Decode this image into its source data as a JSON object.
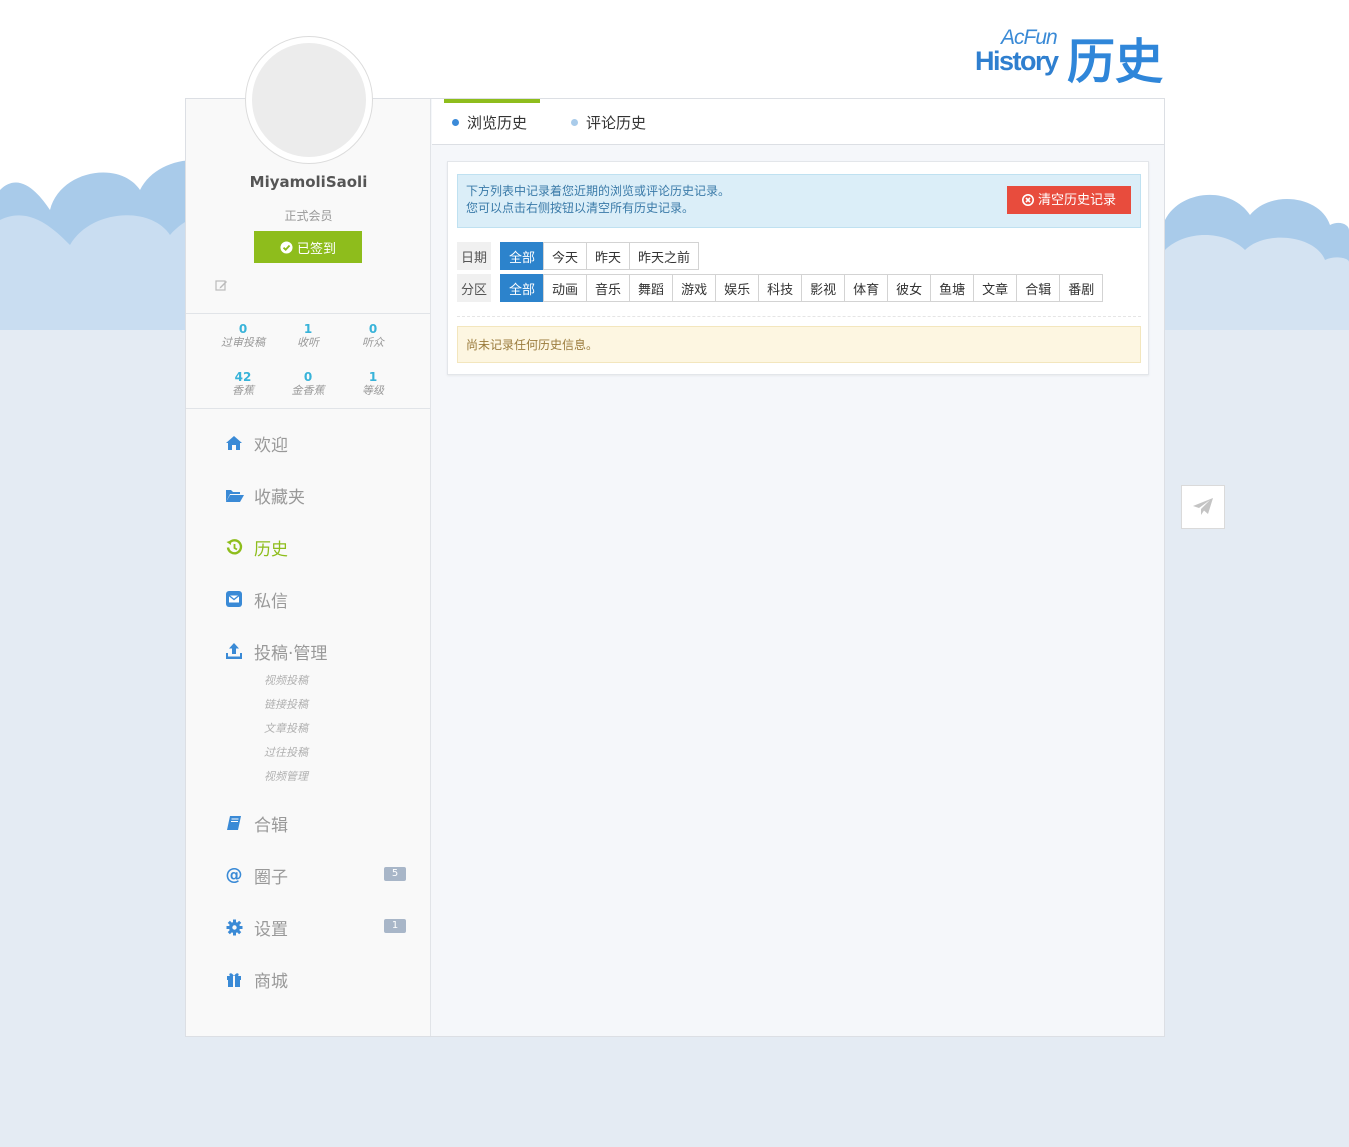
{
  "header": {
    "logo_acfun": "AcFun",
    "logo_history": "History",
    "logo_cn": "历史"
  },
  "profile": {
    "username": "MiyamoliSaoli",
    "member_level": "正式会员",
    "signed_label": "已签到"
  },
  "stats": [
    {
      "num": "0",
      "label": "过审投稿"
    },
    {
      "num": "1",
      "label": "收听"
    },
    {
      "num": "0",
      "label": "听众"
    },
    {
      "num": "42",
      "label": "香蕉"
    },
    {
      "num": "0",
      "label": "金香蕉"
    },
    {
      "num": "1",
      "label": "等级"
    }
  ],
  "nav": {
    "welcome": "欢迎",
    "favorites": "收藏夹",
    "history": "历史",
    "messages": "私信",
    "upload": "投稿·管理",
    "upload_sub": [
      "视频投稿",
      "链接投稿",
      "文章投稿",
      "过往投稿",
      "视频管理"
    ],
    "album": "合辑",
    "circle": "圈子",
    "circle_badge": "5",
    "settings": "设置",
    "settings_badge": "1",
    "shop": "商城"
  },
  "tabs": [
    "浏览历史",
    "评论历史"
  ],
  "info": {
    "line1": "下方列表中记录着您近期的浏览或评论历史记录。",
    "line2": "您可以点击右侧按钮以清空所有历史记录。",
    "clear_button": "清空历史记录"
  },
  "filters": {
    "date_label": "日期",
    "date_options": [
      "全部",
      "今天",
      "昨天",
      "昨天之前"
    ],
    "channel_label": "分区",
    "channel_options": [
      "全部",
      "动画",
      "音乐",
      "舞蹈",
      "游戏",
      "娱乐",
      "科技",
      "影视",
      "体育",
      "彼女",
      "鱼塘",
      "文章",
      "合辑",
      "番剧"
    ]
  },
  "empty_message": "尚未记录任何历史信息。",
  "colors": {
    "accent_green": "#8ebd1c",
    "accent_blue": "#2c83cc",
    "danger_red": "#e84c3d"
  }
}
